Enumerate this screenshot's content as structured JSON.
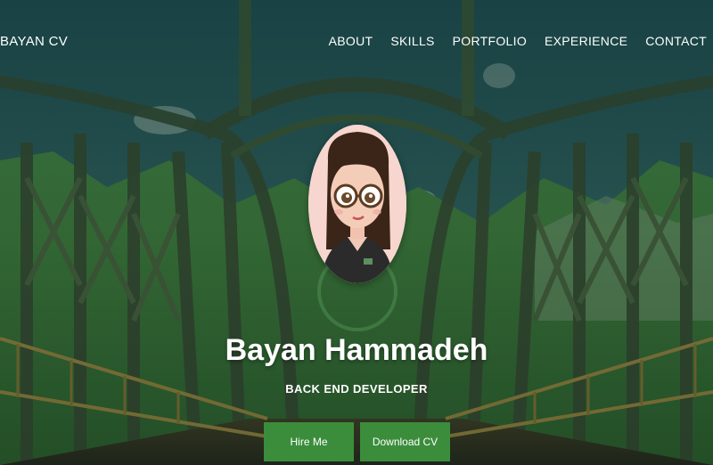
{
  "brand": "BAYAN CV",
  "nav": {
    "items": [
      "ABOUT",
      "SKILLS",
      "PORTFOLIO",
      "EXPERIENCE",
      "CONTACT"
    ]
  },
  "hero": {
    "name": "Bayan Hammadeh",
    "role": "BACK END DEVELOPER",
    "hire_label": "Hire Me",
    "download_label": "Download CV"
  },
  "colors": {
    "button": "#3b8d3c",
    "avatar_bg": "#f6d6ce",
    "text": "#ffffff"
  }
}
